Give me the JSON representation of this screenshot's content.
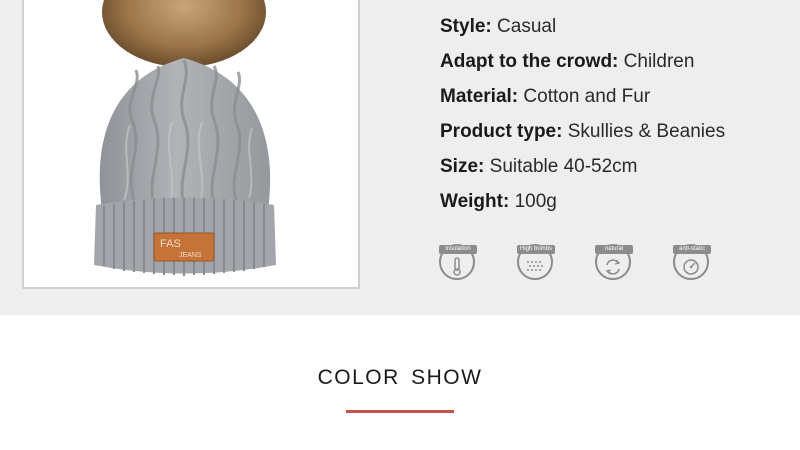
{
  "specs": [
    {
      "label": "Style:",
      "value": "Casual"
    },
    {
      "label": "Adapt to the crowd:",
      "value": "Children"
    },
    {
      "label": "Material:",
      "value": "Cotton and Fur"
    },
    {
      "label": "Product type:",
      "value": "Skullies & Beanies"
    },
    {
      "label": "Size:",
      "value": "Suitable 40-52cm"
    },
    {
      "label": "Weight:",
      "value": "100g"
    }
  ],
  "badges": [
    {
      "label": "insulation",
      "icon": "thermometer-icon"
    },
    {
      "label": "High bombs",
      "icon": "knit-texture-icon"
    },
    {
      "label": "natural",
      "icon": "cycle-arrows-icon"
    },
    {
      "label": "anti-static",
      "icon": "gauge-icon"
    }
  ],
  "product_image": {
    "patch_line1": "FAS",
    "patch_line2": "JEANS"
  },
  "color_show": {
    "title": "COLOR  SHOW"
  },
  "colors": {
    "band": "#efeeee",
    "accent": "#c9504a",
    "hat": "#a6a9ad",
    "patch": "#c6733a"
  }
}
